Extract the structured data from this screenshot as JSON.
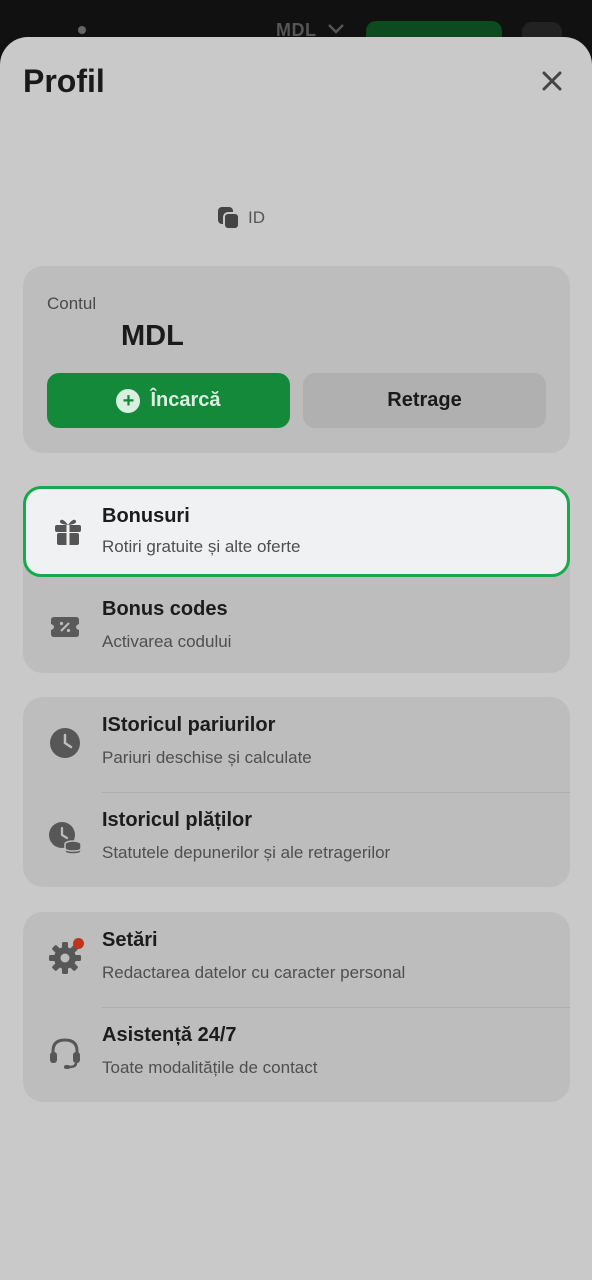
{
  "topbar": {
    "currency": "MDL"
  },
  "sheet": {
    "title": "Profil",
    "id_label": "ID"
  },
  "account": {
    "label": "Contul",
    "currency": "MDL",
    "deposit_label": "Încarcă",
    "withdraw_label": "Retrage"
  },
  "bonus_group": {
    "items": [
      {
        "title": "Bonusuri",
        "subtitle": "Rotiri gratuite și alte oferte",
        "icon": "gift-icon"
      },
      {
        "title": "Bonus codes",
        "subtitle": "Activarea codului",
        "icon": "coupon-icon"
      }
    ]
  },
  "history_group": {
    "items": [
      {
        "title": "IStoricul pariurilor",
        "subtitle": "Pariuri deschise și calculate",
        "icon": "clock-icon"
      },
      {
        "title": "Istoricul plăților",
        "subtitle": "Statutele depunerilor și ale retragerilor",
        "icon": "payment-history-icon"
      }
    ]
  },
  "settings_group": {
    "items": [
      {
        "title": "Setări",
        "subtitle": "Redactarea datelor cu caracter personal",
        "icon": "gear-icon"
      },
      {
        "title": "Asistență 24/7",
        "subtitle": "Toate modalitățile de contact",
        "icon": "headset-icon"
      }
    ]
  },
  "colors": {
    "accent": "#14893a",
    "highlight_border": "#18a94a",
    "notification_dot": "#c0341d"
  }
}
